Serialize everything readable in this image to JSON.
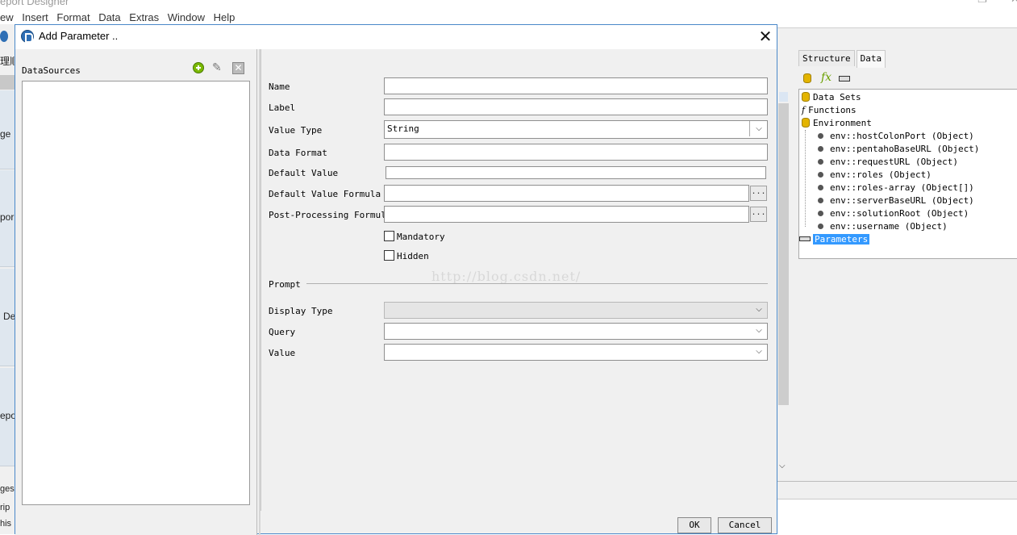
{
  "app": {
    "title": "Report Designer",
    "title_visible": "eport Designer",
    "menu": [
      "ew",
      "Insert",
      "Format",
      "Data",
      "Extras",
      "Window",
      "Help"
    ],
    "left_fragments": [
      "理顺",
      "ge",
      "por",
      "De",
      "epo",
      "ges",
      "rip",
      "his"
    ]
  },
  "dialog": {
    "title": "Add Parameter ..",
    "close_glyph": "✕"
  },
  "datasources": {
    "label": "DataSources"
  },
  "form": {
    "name_label": "Name",
    "name_value": "",
    "label_label": "Label",
    "label_value": "",
    "value_type_label": "Value Type",
    "value_type_value": "String",
    "data_format_label": "Data Format",
    "data_format_value": "",
    "default_value_label": "Default Value",
    "default_value_value": "",
    "default_value_formula_label": "Default Value Formula",
    "post_processing_formula_label": "Post-Processing Formula",
    "ellipsis": "...",
    "mandatory_label": "Mandatory",
    "mandatory_checked": false,
    "hidden_label": "Hidden",
    "hidden_checked": false,
    "prompt_label": "Prompt",
    "display_type_label": "Display Type",
    "display_type_value": "",
    "query_label": "Query",
    "query_value": "",
    "value_label": "Value",
    "value_value": ""
  },
  "buttons": {
    "ok": "OK",
    "cancel": "Cancel"
  },
  "watermark": "http://blog.csdn.net/",
  "data_panel": {
    "tabs": [
      "Structure",
      "Data"
    ],
    "active_tab": "Data",
    "tree": {
      "data_sets": "Data Sets",
      "functions": "Functions",
      "environment": "Environment",
      "env_items": [
        "env::hostColonPort (Object)",
        "env::pentahoBaseURL (Object)",
        "env::requestURL (Object)",
        "env::roles (Object)",
        "env::roles-array (Object[])",
        "env::serverBaseURL (Object)",
        "env::solutionRoot (Object)",
        "env::username (Object)"
      ],
      "parameters": "Parameters"
    }
  },
  "colors": {
    "dialog_border": "#4a88c9",
    "selection": "#3399ff",
    "database_icon": "#e3b400"
  }
}
